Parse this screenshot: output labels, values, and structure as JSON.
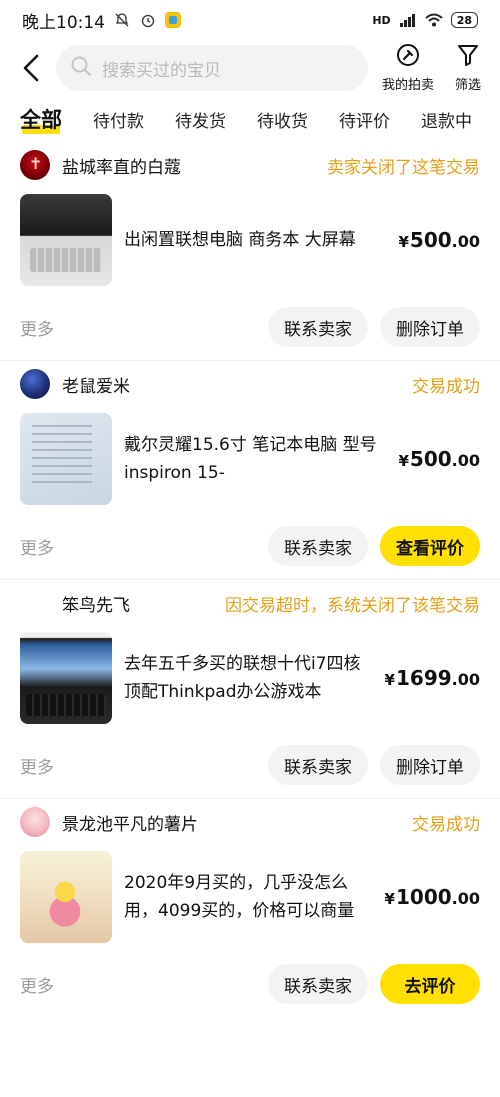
{
  "status_bar": {
    "time": "晚上10:14",
    "battery": "28",
    "signal_label": "HD"
  },
  "search": {
    "placeholder": "搜索买过的宝贝"
  },
  "top_actions": {
    "auction_label": "我的拍卖",
    "filter_label": "筛选"
  },
  "tabs": [
    "全部",
    "待付款",
    "待发货",
    "待收货",
    "待评价",
    "退款中"
  ],
  "orders": [
    {
      "seller": "盐城率直的白蔻",
      "status": "卖家关闭了这笔交易",
      "title": "出闲置联想电脑 商务本 大屏幕",
      "price_int": "500",
      "price_dec": ".00",
      "currency": "¥",
      "more": "更多",
      "buttons": [
        "联系卖家",
        "删除订单"
      ]
    },
    {
      "seller": "老鼠爱米",
      "status": "交易成功",
      "title": "戴尔灵耀15.6寸 笔记本电脑 型号inspiron 15-",
      "price_int": "500",
      "price_dec": ".00",
      "currency": "¥",
      "more": "更多",
      "buttons": [
        "联系卖家",
        "查看评价"
      ]
    },
    {
      "seller": "笨鸟先飞",
      "status": "因交易超时，系统关闭了该笔交易",
      "title": "去年五千多买的联想十代i7四核顶配Thinkpad办公游戏本",
      "price_int": "1699",
      "price_dec": ".00",
      "currency": "¥",
      "more": "更多",
      "buttons": [
        "联系卖家",
        "删除订单"
      ]
    },
    {
      "seller": "景龙池平凡的薯片",
      "status": "交易成功",
      "title": "2020年9月买的，几乎没怎么用，4099买的，价格可以商量",
      "price_int": "1000",
      "price_dec": ".00",
      "currency": "¥",
      "more": "更多",
      "buttons": [
        "联系卖家",
        "去评价"
      ]
    }
  ],
  "colors": {
    "accent": "#ffe000",
    "status": "#e3a11b",
    "muted": "#9c9c9c"
  }
}
